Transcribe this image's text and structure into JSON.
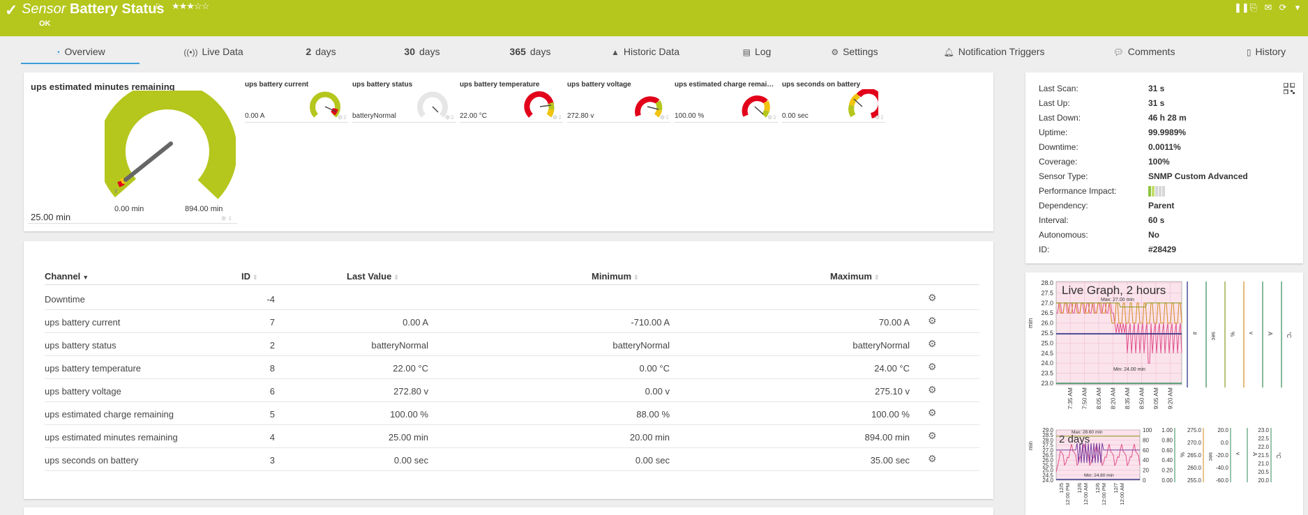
{
  "header": {
    "title_kind": "Sensor",
    "title_name": "Battery Status",
    "status": "OK",
    "stars": "★★★☆☆",
    "tools": [
      "pause-icon",
      "clone-icon",
      "email-icon",
      "refresh-icon",
      "dropdown-icon"
    ]
  },
  "tabs": [
    {
      "label": "Overview",
      "icon": "overview-icon",
      "active": true
    },
    {
      "label": "Live Data",
      "icon": "live-data-icon"
    },
    {
      "num": "2",
      "label": "days"
    },
    {
      "num": "30",
      "label": "days"
    },
    {
      "num": "365",
      "label": "days"
    },
    {
      "label": "Historic Data",
      "icon": "historic-data-icon"
    },
    {
      "label": "Log",
      "icon": "log-icon"
    },
    {
      "label": "Settings",
      "icon": "settings-icon"
    },
    {
      "label": "Notification Triggers",
      "icon": "bell-icon"
    },
    {
      "label": "Comments",
      "icon": "comment-icon"
    },
    {
      "label": "History",
      "icon": "history-icon"
    }
  ],
  "big_gauge": {
    "title": "ups estimated minutes remaining",
    "value": "25.00 min",
    "min_label": "0.00 min",
    "max_label": "894.00 min",
    "fraction": 0.028
  },
  "small_gauges": [
    {
      "label": "ups battery current",
      "value": "0.00 A",
      "kind": "current",
      "needle": 0.91
    },
    {
      "label": "ups battery status",
      "value": "batteryNormal",
      "kind": "status",
      "needle": 0.5
    },
    {
      "label": "ups battery temperature",
      "value": "22.00 °C",
      "kind": "temperature",
      "needle": 0.92
    },
    {
      "label": "ups battery voltage",
      "value": "272.80 v",
      "kind": "voltage",
      "needle": 0.9
    },
    {
      "label": "ups estimated charge remaini...",
      "value": "100.00 %",
      "kind": "charge",
      "needle": 0.8
    },
    {
      "label": "ups seconds on battery",
      "value": "0.00 sec",
      "kind": "seconds",
      "needle": 0.2
    }
  ],
  "table": {
    "headers": {
      "channel": "Channel",
      "id": "ID",
      "last_value": "Last Value",
      "minimum": "Minimum",
      "maximum": "Maximum"
    },
    "rows": [
      {
        "channel": "Downtime",
        "id": "-4",
        "last_value": "",
        "minimum": "",
        "maximum": ""
      },
      {
        "channel": "ups battery current",
        "id": "7",
        "last_value": "0.00 A",
        "minimum": "-710.00 A",
        "maximum": "70.00 A"
      },
      {
        "channel": "ups battery status",
        "id": "2",
        "last_value": "batteryNormal",
        "minimum": "batteryNormal",
        "maximum": "batteryNormal"
      },
      {
        "channel": "ups battery temperature",
        "id": "8",
        "last_value": "22.00 °C",
        "minimum": "0.00 °C",
        "maximum": "24.00 °C"
      },
      {
        "channel": "ups battery voltage",
        "id": "6",
        "last_value": "272.80 v",
        "minimum": "0.00 v",
        "maximum": "275.10 v"
      },
      {
        "channel": "ups estimated charge remaining",
        "id": "5",
        "last_value": "100.00 %",
        "minimum": "88.00 %",
        "maximum": "100.00 %"
      },
      {
        "channel": "ups estimated minutes remaining",
        "id": "4",
        "last_value": "25.00 min",
        "minimum": "20.00 min",
        "maximum": "894.00 min"
      },
      {
        "channel": "ups seconds on battery",
        "id": "3",
        "last_value": "0.00 sec",
        "minimum": "0.00 sec",
        "maximum": "35.00 sec"
      }
    ]
  },
  "info": [
    {
      "label": "Last Scan:",
      "value": "31 s"
    },
    {
      "label": "Last Up:",
      "value": "31 s"
    },
    {
      "label": "Last Down:",
      "value": "46 h 28 m"
    },
    {
      "label": "Uptime:",
      "value": "99.9989%"
    },
    {
      "label": "Downtime:",
      "value": "0.0011%"
    },
    {
      "label": "Coverage:",
      "value": "100%"
    },
    {
      "label": "Sensor Type:",
      "value": "SNMP Custom Advanced"
    },
    {
      "label": "Performance Impact:",
      "value": ""
    },
    {
      "label": "Dependency:",
      "value": "Parent"
    },
    {
      "label": "Interval:",
      "value": "60 s"
    },
    {
      "label": "Autonomous:",
      "value": "No"
    },
    {
      "label": "ID:",
      "value": "#28429"
    }
  ],
  "performance_impact_level": 0.4,
  "colors": {
    "brand": "#b5c61d",
    "accent": "#3b9dd8",
    "alarm": "#e2001a",
    "warn": "#f1c40f"
  },
  "chart_data": [
    {
      "type": "line",
      "title": "Live Graph, 2 hours",
      "ylabel": "min",
      "ylim": [
        23.0,
        28.0
      ],
      "yticks": [
        "28.0",
        "27.5",
        "27.0",
        "26.5",
        "26.0",
        "25.5",
        "25.0",
        "24.5",
        "24.0",
        "23.5",
        "23.0"
      ],
      "xticks": [
        "7:35 AM",
        "7:50 AM",
        "8:05 AM",
        "8:20 AM",
        "8:35 AM",
        "8:50 AM",
        "9:05 AM",
        "9:20 AM"
      ],
      "unit_axes": [
        "#",
        "sec",
        "%",
        "v",
        "A",
        "°C"
      ],
      "max_label": "Max: 27.00 min",
      "min_label": "Min: 24.00 min"
    },
    {
      "type": "line",
      "title": "2 days",
      "ylabel": "min",
      "ylim": [
        24.0,
        29.0
      ],
      "yticks": [
        "29.0",
        "28.5",
        "28.0",
        "27.5",
        "27.0",
        "26.5",
        "26.0",
        "25.5",
        "25.0",
        "24.5",
        "24.0"
      ],
      "right_yticks": [
        "100",
        "80",
        "60",
        "40",
        "20",
        "0"
      ],
      "xticks": [
        "12/5 12:00 PM",
        "12/6 12:00 AM",
        "12/6 12:00 PM",
        "12/7 12:00 AM"
      ],
      "max_label": "Max: 28.60 min",
      "min_label": "Min: 24.80 min",
      "unit_axes": [
        {
          "name": "%",
          "ticks": [
            "1.00",
            "0.80",
            "0.60",
            "0.40",
            "0.20",
            "0.00"
          ]
        },
        {
          "name": "sec",
          "ticks": [
            "275.0",
            "270.0",
            "265.0",
            "260.0",
            "255.0"
          ]
        },
        {
          "name": "v",
          "ticks": [
            "20.0",
            "0.0",
            "-20.0",
            "-40.0",
            "-60.0"
          ]
        },
        {
          "name": "A",
          "ticks": []
        },
        {
          "name": "°C",
          "ticks": [
            "23.0",
            "22.5",
            "22.0",
            "21.5",
            "21.0",
            "20.5",
            "20.0"
          ]
        }
      ]
    }
  ]
}
